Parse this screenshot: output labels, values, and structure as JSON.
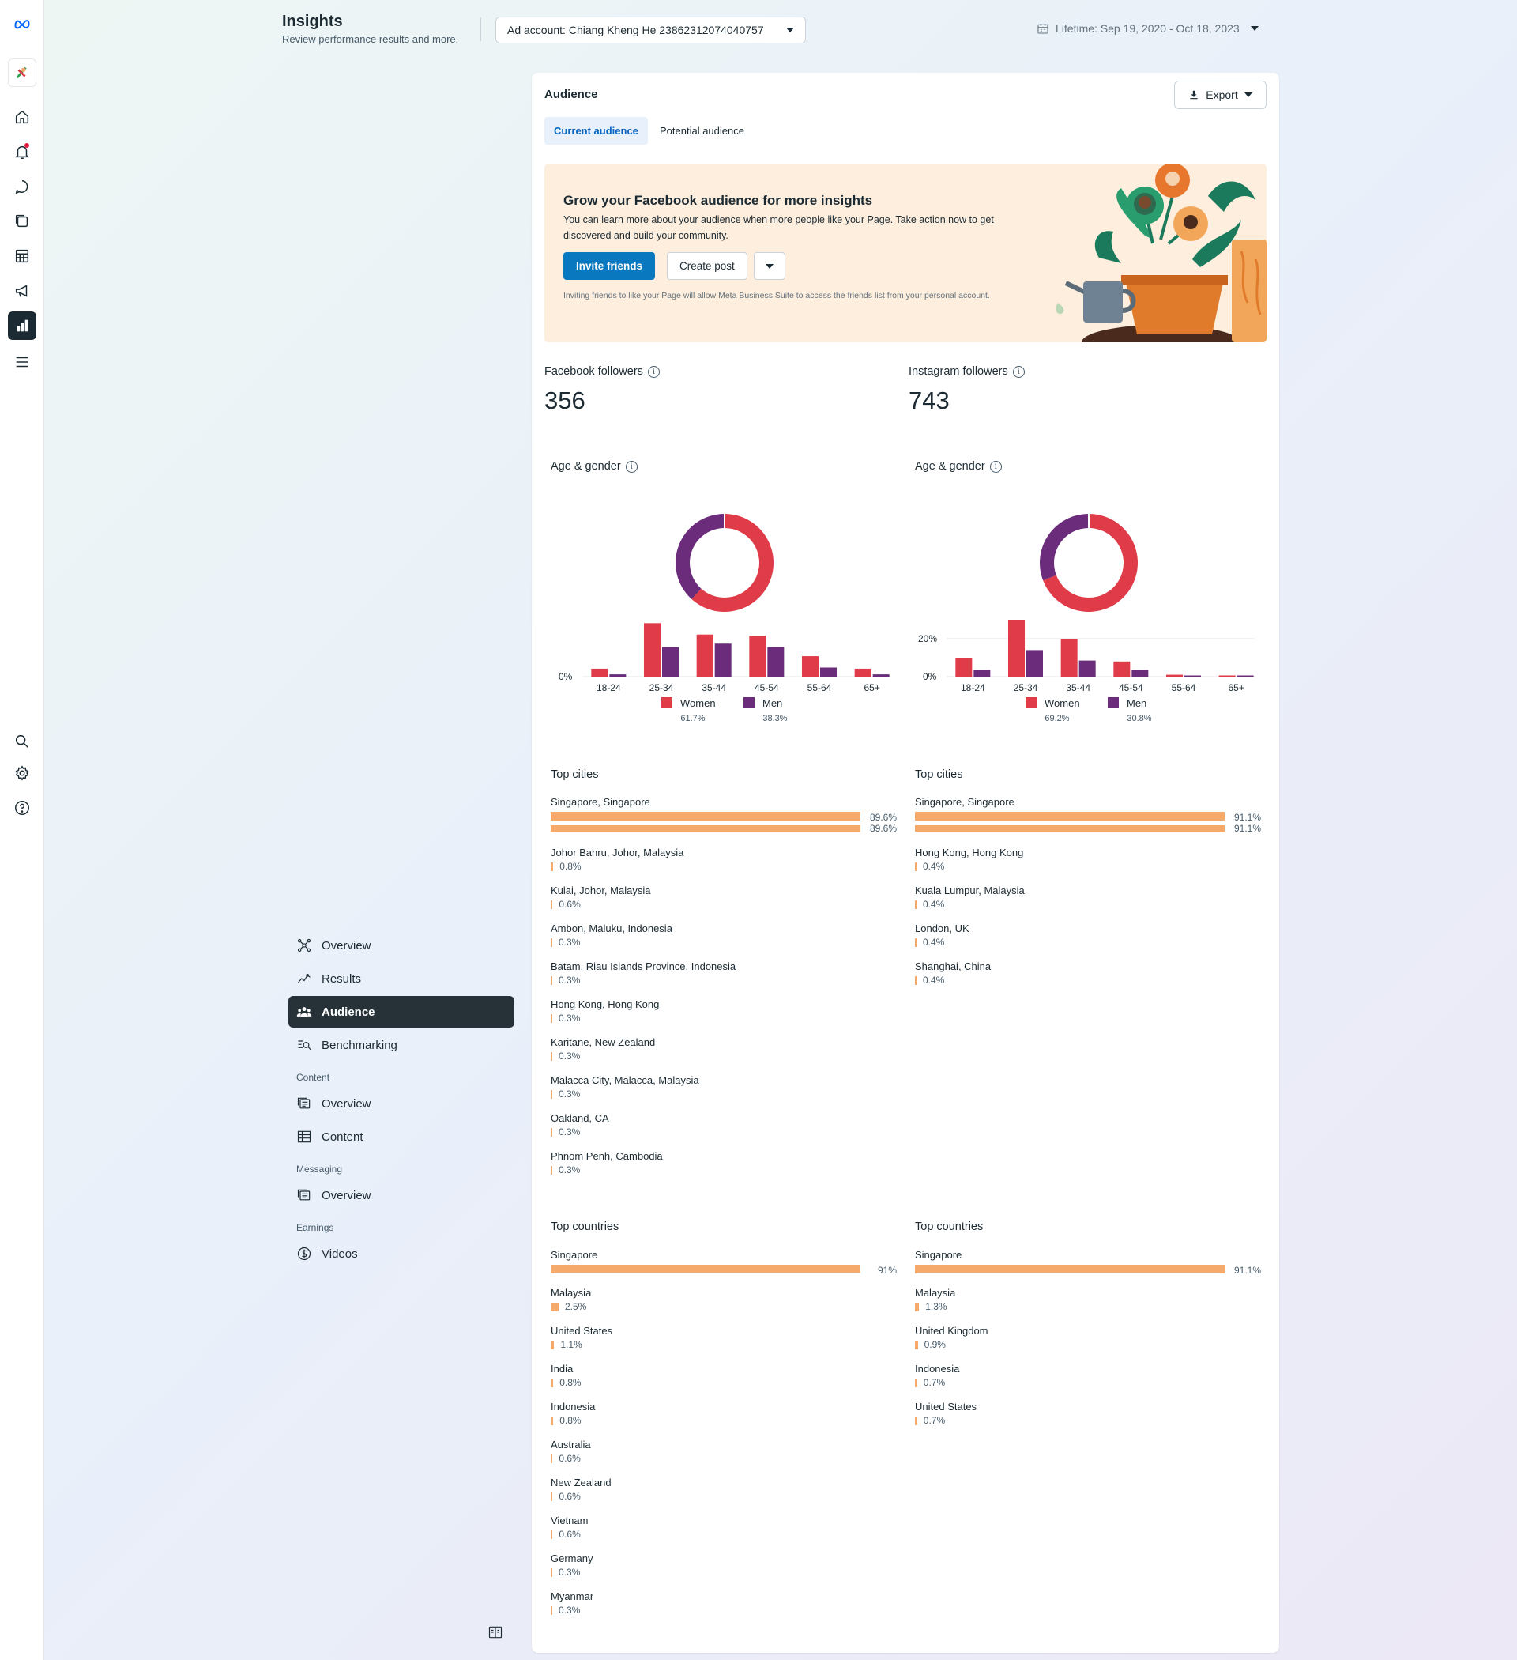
{
  "header": {
    "title": "Insights",
    "subtitle": "Review performance results and more.",
    "account_label": "Ad account: Chiang Kheng He 2386231207404075​7",
    "date_range": "Lifetime: Sep 19, 2020 - Oct 18, 2023"
  },
  "rail": {
    "icons": [
      "meta-logo-icon",
      "profile-avatar",
      "home-icon",
      "notifications-icon",
      "inbox-icon",
      "content-icon",
      "planner-icon",
      "ads-icon",
      "insights-icon",
      "menu-icon",
      "search-icon",
      "settings-icon",
      "help-icon"
    ]
  },
  "subnav": {
    "items": [
      {
        "label": "Overview"
      },
      {
        "label": "Results"
      },
      {
        "label": "Audience"
      },
      {
        "label": "Benchmarking"
      }
    ],
    "content_group": "Content",
    "content_items": [
      {
        "label": "Overview"
      },
      {
        "label": "Content"
      }
    ],
    "messaging_group": "Messaging",
    "messaging_items": [
      {
        "label": "Overview"
      }
    ],
    "earnings_group": "Earnings",
    "earnings_items": [
      {
        "label": "Videos"
      }
    ]
  },
  "card": {
    "title": "Audience",
    "export_label": "Export",
    "tabs": [
      {
        "label": "Current audience"
      },
      {
        "label": "Potential audience"
      }
    ]
  },
  "banner": {
    "title": "Grow your Facebook audience for more insights",
    "text": "You can learn more about your audience when more people like your Page. Take action now to get discovered and build your community.",
    "invite_label": "Invite friends",
    "create_post_label": "Create post",
    "note": "Inviting friends to like your Page will allow Meta Business Suite to access the friends list from your personal account."
  },
  "followers": {
    "facebook_label": "Facebook followers",
    "facebook_value": "356",
    "instagram_label": "Instagram followers",
    "instagram_value": "743"
  },
  "colors": {
    "women": "#e03b48",
    "men": "#6b2d7b",
    "bar": "#f5a96b",
    "accent": "#0a78be"
  },
  "chart_data": [
    {
      "type": "bar",
      "title": "Age & gender",
      "categories": [
        "18-24",
        "25-34",
        "35-44",
        "45-54",
        "55-64",
        "65+"
      ],
      "series": [
        {
          "name": "Women",
          "values": [
            3.5,
            23.5,
            18.5,
            18,
            9,
            3.5
          ]
        },
        {
          "name": "Men",
          "values": [
            1,
            13,
            14.5,
            13,
            4,
            1
          ]
        }
      ],
      "yticks": [
        "0%"
      ],
      "ylim": [
        0,
        25
      ],
      "donut": {
        "Women": 61.7,
        "Men": 38.3
      },
      "legend": [
        {
          "label": "Women",
          "pct": "61.7%"
        },
        {
          "label": "Men",
          "pct": "38.3%"
        }
      ]
    },
    {
      "type": "bar",
      "title": "Age & gender",
      "categories": [
        "18-24",
        "25-34",
        "35-44",
        "45-54",
        "55-64",
        "65+"
      ],
      "series": [
        {
          "name": "Women",
          "values": [
            10,
            30,
            20,
            8,
            1,
            0.5
          ]
        },
        {
          "name": "Men",
          "values": [
            3.5,
            14,
            8.5,
            3.5,
            0.5,
            0.5
          ]
        }
      ],
      "yticks": [
        "0%",
        "20%"
      ],
      "ylim": [
        0,
        30
      ],
      "donut": {
        "Women": 69.2,
        "Men": 30.8
      },
      "legend": [
        {
          "label": "Women",
          "pct": "69.2%"
        },
        {
          "label": "Men",
          "pct": "30.8%"
        }
      ]
    }
  ],
  "cities": {
    "title": "Top cities",
    "facebook": [
      {
        "name": "Singapore, Singapore",
        "value": 89.6,
        "pct": "89.6%"
      },
      {
        "name": "Johor Bahru, Johor, Malaysia",
        "value": 0.8,
        "pct": "0.8%"
      },
      {
        "name": "Kulai, Johor, Malaysia",
        "value": 0.6,
        "pct": "0.6%"
      },
      {
        "name": "Ambon, Maluku, Indonesia",
        "value": 0.3,
        "pct": "0.3%"
      },
      {
        "name": "Batam, Riau Islands Province, Indonesia",
        "value": 0.3,
        "pct": "0.3%"
      },
      {
        "name": "Hong Kong, Hong Kong",
        "value": 0.3,
        "pct": "0.3%"
      },
      {
        "name": "Karitane, New Zealand",
        "value": 0.3,
        "pct": "0.3%"
      },
      {
        "name": "Malacca City, Malacca, Malaysia",
        "value": 0.3,
        "pct": "0.3%"
      },
      {
        "name": "Oakland, CA",
        "value": 0.3,
        "pct": "0.3%"
      },
      {
        "name": "Phnom Penh, Cambodia",
        "value": 0.3,
        "pct": "0.3%"
      }
    ],
    "instagram": [
      {
        "name": "Singapore, Singapore",
        "value": 91.1,
        "pct": "91.1%"
      },
      {
        "name": "Hong Kong, Hong Kong",
        "value": 0.4,
        "pct": "0.4%"
      },
      {
        "name": "Kuala Lumpur, Malaysia",
        "value": 0.4,
        "pct": "0.4%"
      },
      {
        "name": "London, UK",
        "value": 0.4,
        "pct": "0.4%"
      },
      {
        "name": "Shanghai, China",
        "value": 0.4,
        "pct": "0.4%"
      }
    ]
  },
  "countries": {
    "title": "Top countries",
    "facebook": [
      {
        "name": "Singapore",
        "value": 91,
        "pct": "91%"
      },
      {
        "name": "Malaysia",
        "value": 2.5,
        "pct": "2.5%"
      },
      {
        "name": "United States",
        "value": 1.1,
        "pct": "1.1%"
      },
      {
        "name": "India",
        "value": 0.8,
        "pct": "0.8%"
      },
      {
        "name": "Indonesia",
        "value": 0.8,
        "pct": "0.8%"
      },
      {
        "name": "Australia",
        "value": 0.6,
        "pct": "0.6%"
      },
      {
        "name": "New Zealand",
        "value": 0.6,
        "pct": "0.6%"
      },
      {
        "name": "Vietnam",
        "value": 0.6,
        "pct": "0.6%"
      },
      {
        "name": "Germany",
        "value": 0.3,
        "pct": "0.3%"
      },
      {
        "name": "Myanmar",
        "value": 0.3,
        "pct": "0.3%"
      }
    ],
    "instagram": [
      {
        "name": "Singapore",
        "value": 91.1,
        "pct": "91.1%"
      },
      {
        "name": "Malaysia",
        "value": 1.3,
        "pct": "1.3%"
      },
      {
        "name": "United Kingdom",
        "value": 0.9,
        "pct": "0.9%"
      },
      {
        "name": "Indonesia",
        "value": 0.7,
        "pct": "0.7%"
      },
      {
        "name": "United States",
        "value": 0.7,
        "pct": "0.7%"
      }
    ]
  }
}
